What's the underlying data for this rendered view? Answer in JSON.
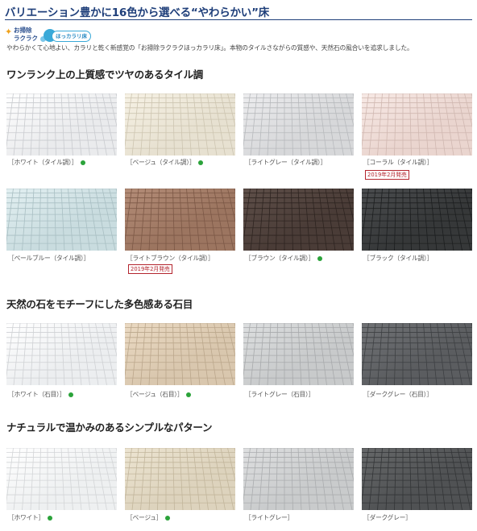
{
  "page": {
    "title": "バリエーション豊かに16色から選べる“やわらかい”床",
    "logo": {
      "line1": "お掃除",
      "line2": "ラクラク",
      "badge": "ほっカラリ床"
    },
    "intro": "やわらかくて心地よい、カラリと乾く新感覚の「お掃除ラクラクほっカラリ床」。本物のタイルさながらの質感や、天然石の風合いを追求しました。"
  },
  "sections": [
    {
      "heading": "ワンランク上の上質感でツヤのあるタイル調",
      "items": [
        {
          "label": "［ホワイト（タイル調）］",
          "dot": true,
          "release": "",
          "color": "#eaebed",
          "line": "#c9cbcf",
          "hi": "#ffffff"
        },
        {
          "label": "［ベージュ（タイル調）］",
          "dot": true,
          "release": "",
          "color": "#e7e1d1",
          "line": "#cdc5b1",
          "hi": "#f6f1e4"
        },
        {
          "label": "［ライトグレー（タイル調）］",
          "dot": false,
          "release": "",
          "color": "#d7d8da",
          "line": "#b8babd",
          "hi": "#ececee"
        },
        {
          "label": "［コーラル（タイル調）］",
          "dot": false,
          "release": "2019年2月発売",
          "color": "#ead5cf",
          "line": "#d0b8b1",
          "hi": "#f7e9e5"
        },
        {
          "label": "［ペールブルー（タイル調）］",
          "dot": false,
          "release": "",
          "color": "#c9dcdf",
          "line": "#a9bfc3",
          "hi": "#e2eff1"
        },
        {
          "label": "［ライトブラウン（タイル調）］",
          "dot": false,
          "release": "2019年2月発売",
          "color": "#9c7560",
          "line": "#7c5846",
          "hi": "#b38c77"
        },
        {
          "label": "［ブラウン（タイル調）］",
          "dot": true,
          "release": "",
          "color": "#4a3c37",
          "line": "#2e2420",
          "hi": "#5e4f49"
        },
        {
          "label": "［ブラック（タイル調）］",
          "dot": false,
          "release": "",
          "color": "#363839",
          "line": "#1c1e1f",
          "hi": "#4a4c4e"
        }
      ]
    },
    {
      "heading": "天然の石をモチーフにした多色感ある石目",
      "items": [
        {
          "label": "［ホワイト（石目）］",
          "dot": true,
          "release": "",
          "color": "#eceef0",
          "line": "#cfd1d4",
          "hi": "#ffffff"
        },
        {
          "label": "［ベージュ（石目）］",
          "dot": true,
          "release": "",
          "color": "#d9c7ae",
          "line": "#bba78c",
          "hi": "#ead9c2"
        },
        {
          "label": "［ライトグレー（石目）］",
          "dot": false,
          "release": "",
          "color": "#c8cacb",
          "line": "#a8aaac",
          "hi": "#dcdedf"
        },
        {
          "label": "［ダークグレー（石目）］",
          "dot": false,
          "release": "",
          "color": "#5b5d60",
          "line": "#3e4043",
          "hi": "#707275"
        }
      ]
    },
    {
      "heading": "ナチュラルで温かみのあるシンプルなパターン",
      "items": [
        {
          "label": "［ホワイト］",
          "dot": true,
          "release": "",
          "color": "#eef0f1",
          "line": "#d3d5d7",
          "hi": "#ffffff"
        },
        {
          "label": "［ベージュ］",
          "dot": true,
          "release": "",
          "color": "#ddd3bd",
          "line": "#c2b69c",
          "hi": "#ece4d1"
        },
        {
          "label": "［ライトグレー］",
          "dot": false,
          "release": "",
          "color": "#c9cbcc",
          "line": "#abadaf",
          "hi": "#dedfe0"
        },
        {
          "label": "［ダークグレー］",
          "dot": false,
          "release": "",
          "color": "#505254",
          "line": "#333537",
          "hi": "#666869"
        }
      ]
    }
  ]
}
